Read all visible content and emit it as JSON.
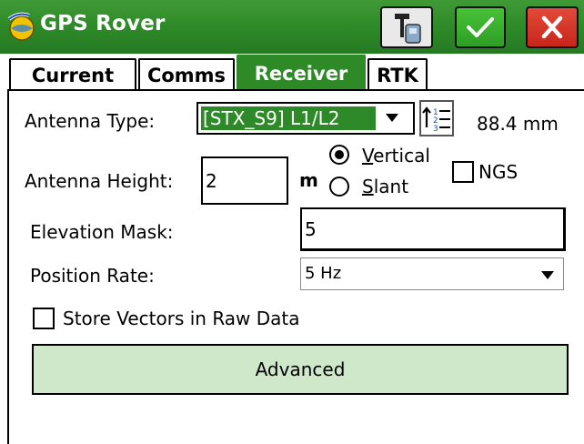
{
  "titlebar": {
    "title": "GPS Rover",
    "icons": {
      "logo": "satellite-globe-icon",
      "tool": "antenna-tool-icon",
      "accept": "checkmark-icon",
      "close": "close-x-icon"
    },
    "colors": {
      "bar": "#2e8a28",
      "accept": "#2e9e25",
      "close": "#c7261a",
      "title_text": "#ffffff"
    }
  },
  "tabs": [
    {
      "label": "Current",
      "active": false
    },
    {
      "label": "Comms",
      "active": false
    },
    {
      "label": "Receiver",
      "active": true
    },
    {
      "label": "RTK",
      "active": false
    }
  ],
  "form": {
    "antenna_type": {
      "label": "Antenna Type:",
      "value": "[STX_S9] L1/L2",
      "offset_text": "88.4 mm"
    },
    "antenna_height": {
      "label": "Antenna Height:",
      "value": "2",
      "unit": "m",
      "vertical_label": "Vertical",
      "slant_label": "Slant",
      "selected": "Vertical",
      "ngs_label": "NGS",
      "ngs_checked": false
    },
    "elevation_mask": {
      "label": "Elevation Mask:",
      "value": "5"
    },
    "position_rate": {
      "label": "Position Rate:",
      "value": "5 Hz"
    },
    "store_vectors": {
      "label": "Store Vectors in Raw Data",
      "checked": false
    },
    "advanced_button": {
      "label": "Advanced",
      "color": "#cfe8c9"
    }
  }
}
